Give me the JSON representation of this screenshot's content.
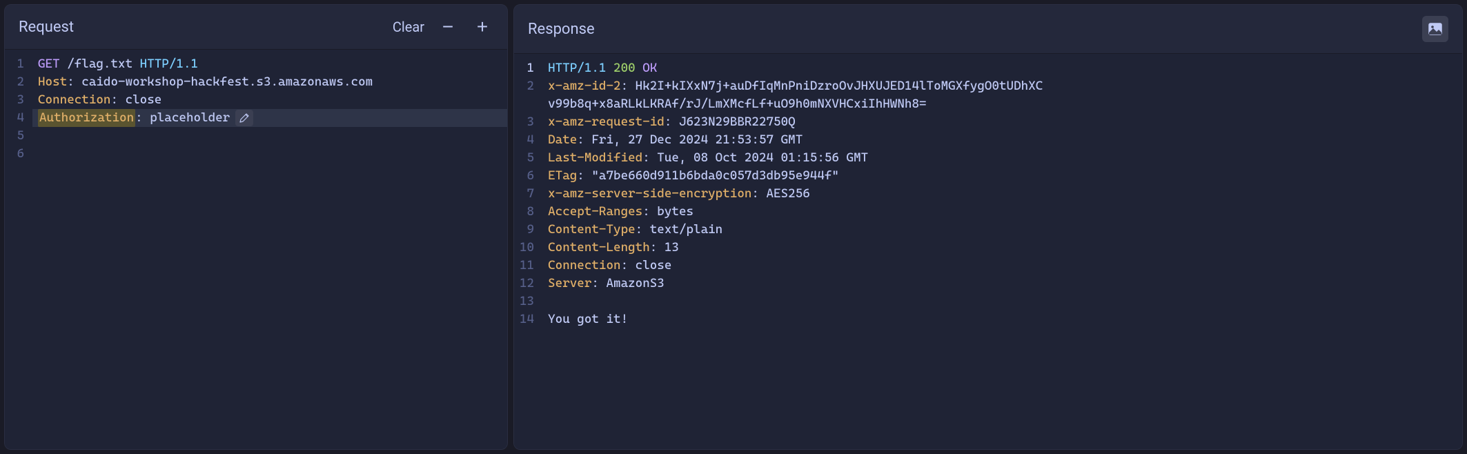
{
  "request": {
    "title": "Request",
    "actions": {
      "clear": "Clear"
    },
    "lines": [
      {
        "num": "1",
        "segments": [
          {
            "cls": "method",
            "text": "GET"
          },
          {
            "cls": "path",
            "text": " /flag.txt "
          },
          {
            "cls": "protocol",
            "text": "HTTP/1.1"
          }
        ]
      },
      {
        "num": "2",
        "segments": [
          {
            "cls": "header-name",
            "text": "Host"
          },
          {
            "cls": "header-value",
            "text": ": caido-workshop-hackfest.s3.amazonaws.com"
          }
        ]
      },
      {
        "num": "3",
        "segments": [
          {
            "cls": "header-name",
            "text": "Connection"
          },
          {
            "cls": "header-value",
            "text": ": close"
          }
        ]
      },
      {
        "num": "4",
        "highlighted": true,
        "hasEdit": true,
        "segments": [
          {
            "cls": "auth-highlight",
            "text": "Authorization"
          },
          {
            "cls": "header-value",
            "text": ": placeholder"
          }
        ]
      },
      {
        "num": "5",
        "segments": []
      },
      {
        "num": "6",
        "segments": []
      }
    ]
  },
  "response": {
    "title": "Response",
    "lines": [
      {
        "num": "1",
        "active": true,
        "segments": [
          {
            "cls": "protocol",
            "text": "HTTP/1.1 "
          },
          {
            "cls": "status-code",
            "text": "200 "
          },
          {
            "cls": "status-text",
            "text": "OK"
          }
        ]
      },
      {
        "num": "2",
        "segments": [
          {
            "cls": "header-name",
            "text": "x-amz-id-2"
          },
          {
            "cls": "header-value",
            "text": ": Hk2I+kIXxN7j+auDfIqMnPniDzroOvJHXUJED14lToMGXfygO0tUDhXC"
          }
        ]
      },
      {
        "num": "",
        "segments": [
          {
            "cls": "header-value",
            "text": "v99b8q+x8aRLkLKRAf/rJ/LmXMcfLf+uO9h0mNXVHCxiIhHWNh8="
          }
        ]
      },
      {
        "num": "3",
        "segments": [
          {
            "cls": "header-name",
            "text": "x-amz-request-id"
          },
          {
            "cls": "header-value",
            "text": ": J623N29BBR22750Q"
          }
        ]
      },
      {
        "num": "4",
        "segments": [
          {
            "cls": "header-name",
            "text": "Date"
          },
          {
            "cls": "header-value",
            "text": ": Fri, 27 Dec 2024 21:53:57 GMT"
          }
        ]
      },
      {
        "num": "5",
        "segments": [
          {
            "cls": "header-name",
            "text": "Last-Modified"
          },
          {
            "cls": "header-value",
            "text": ": Tue, 08 Oct 2024 01:15:56 GMT"
          }
        ]
      },
      {
        "num": "6",
        "segments": [
          {
            "cls": "header-name",
            "text": "ETag"
          },
          {
            "cls": "header-value",
            "text": ": \"a7be660d911b6bda0c057d3db95e944f\""
          }
        ]
      },
      {
        "num": "7",
        "segments": [
          {
            "cls": "header-name",
            "text": "x-amz-server-side-encryption"
          },
          {
            "cls": "header-value",
            "text": ": AES256"
          }
        ]
      },
      {
        "num": "8",
        "segments": [
          {
            "cls": "header-name",
            "text": "Accept-Ranges"
          },
          {
            "cls": "header-value",
            "text": ": bytes"
          }
        ]
      },
      {
        "num": "9",
        "segments": [
          {
            "cls": "header-name",
            "text": "Content-Type"
          },
          {
            "cls": "header-value",
            "text": ": text/plain"
          }
        ]
      },
      {
        "num": "10",
        "segments": [
          {
            "cls": "header-name",
            "text": "Content-Length"
          },
          {
            "cls": "header-value",
            "text": ": 13"
          }
        ]
      },
      {
        "num": "11",
        "segments": [
          {
            "cls": "header-name",
            "text": "Connection"
          },
          {
            "cls": "header-value",
            "text": ": close"
          }
        ]
      },
      {
        "num": "12",
        "segments": [
          {
            "cls": "header-name",
            "text": "Server"
          },
          {
            "cls": "header-value",
            "text": ": AmazonS3"
          }
        ]
      },
      {
        "num": "13",
        "segments": []
      },
      {
        "num": "14",
        "segments": [
          {
            "cls": "body-text",
            "text": "You got it!"
          }
        ]
      }
    ]
  }
}
